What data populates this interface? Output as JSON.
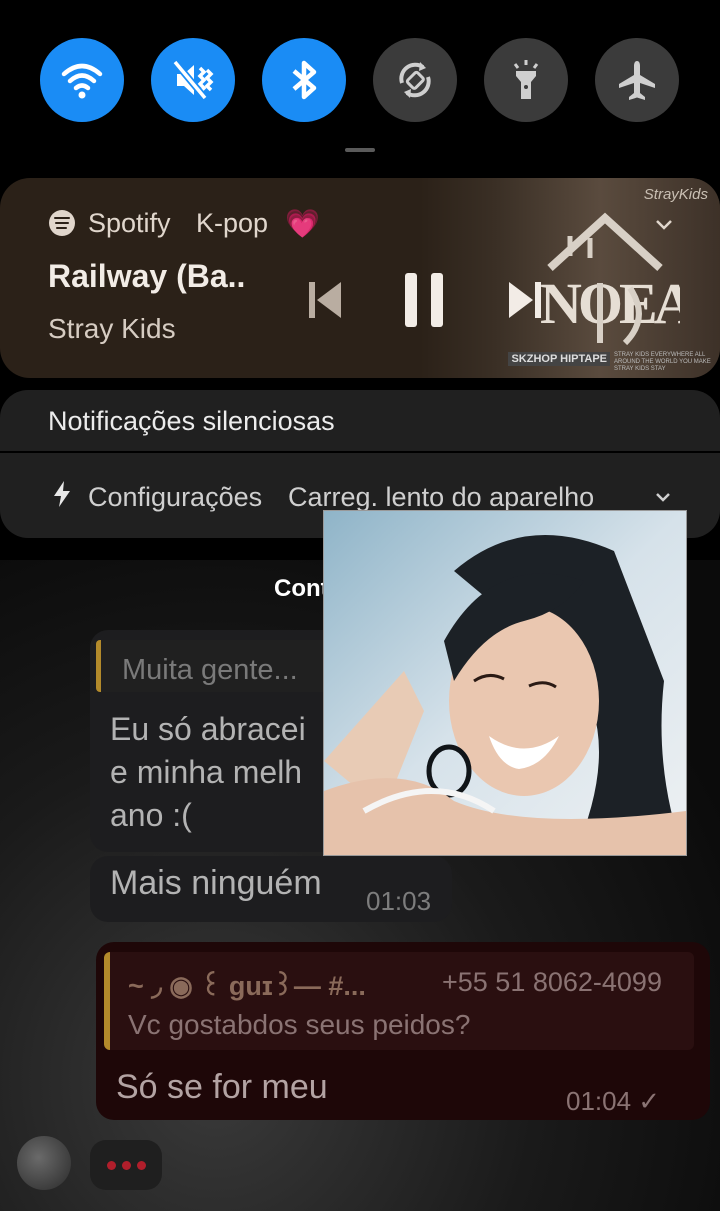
{
  "quick_settings": [
    {
      "name": "wifi",
      "icon": "wifi-icon",
      "state": "on"
    },
    {
      "name": "sound",
      "icon": "mute-icon",
      "state": "on"
    },
    {
      "name": "bluetooth",
      "icon": "bluetooth-icon",
      "state": "on"
    },
    {
      "name": "auto-rotate",
      "icon": "rotate-icon",
      "state": "off"
    },
    {
      "name": "flashlight",
      "icon": "flashlight-icon",
      "state": "off"
    },
    {
      "name": "airplane",
      "icon": "airplane-icon",
      "state": "off"
    }
  ],
  "colors": {
    "accent": "#1a8cf5",
    "media_bg": "#2b2118",
    "panel_bg": "#202020",
    "quote_bar": "#b38a2b"
  },
  "media": {
    "app": "Spotify",
    "playlist": "K-pop",
    "playlist_emoji": "💗",
    "title": "Railway (Ba..",
    "artist": "Stray Kids",
    "album_logo_text": "入 NOEASY",
    "album_signature": "StrayKids",
    "album_tag": "SKZHOP HIPTAPE",
    "album_fineprint": "STRAY KIDS EVERYWHERE ALL AROUND THE WORLD YOU MAKE STRAY KIDS STAY"
  },
  "silent": {
    "title": "Notificações silenciosas",
    "app": "Configurações",
    "text": "Carreg. lento do aparelho"
  },
  "partial_label": "Cont",
  "chat": {
    "incoming_quote": "Muita gente...",
    "incoming_text": "Eu só abracei\ne minha melh\nano :(",
    "incoming_2_text": "Mais ninguém",
    "incoming_2_time": "01:03",
    "outgoing_quote_author": "~ ◞ ◉ ꒰ guɪ꒱— #...",
    "outgoing_quote_phone": "+55 51 8062-4099",
    "outgoing_quote_text": "Vc gostabdos seus peidos?",
    "outgoing_text": "Só se for meu",
    "outgoing_time": "01:04 ✓"
  }
}
